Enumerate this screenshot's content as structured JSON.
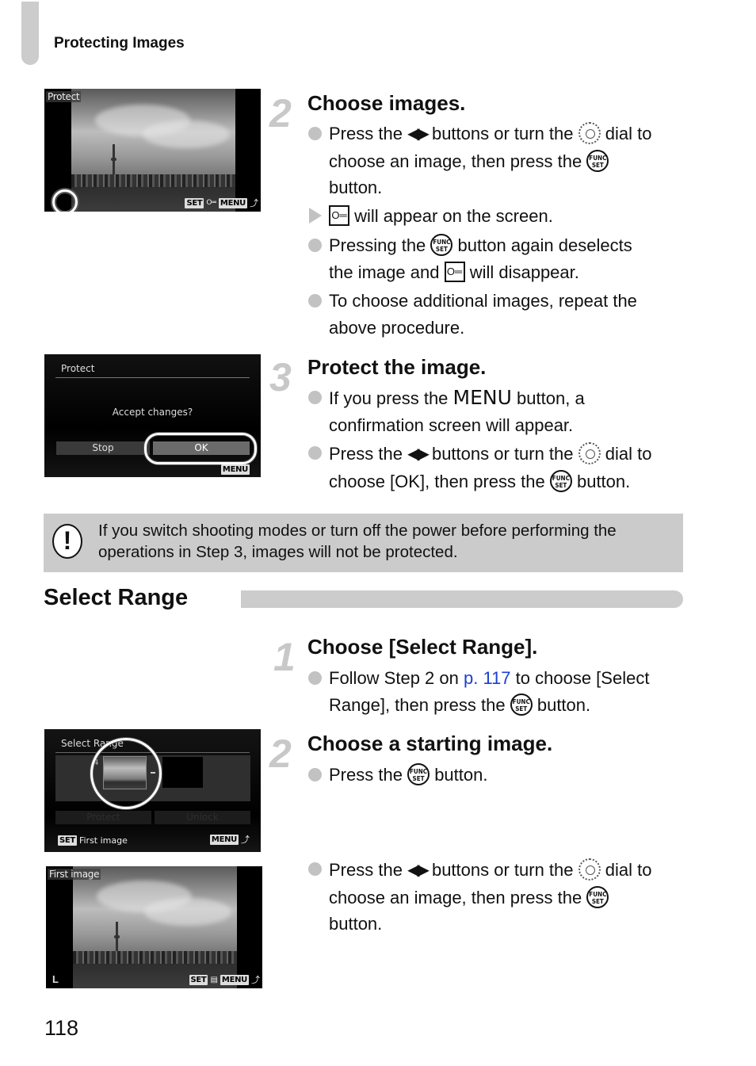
{
  "header": {
    "running_head": "Protecting Images"
  },
  "screens": {
    "choose_images": {
      "label": "Protect",
      "osd_set": "SET",
      "osd_key": "O═",
      "osd_menu": "MENU",
      "osd_back": "⤴"
    },
    "protect_confirm": {
      "title": "Protect",
      "question": "Accept changes?",
      "stop_label": "Stop",
      "ok_label": "OK",
      "osd_menu": "MENU"
    },
    "select_range": {
      "title": "Select Range",
      "counter": "4",
      "protect_label": "Protect",
      "unlock_label": "Unlock",
      "osd_set": "SET",
      "hint": "First image",
      "osd_menu": "MENU"
    },
    "first_image": {
      "label": "First image",
      "size_indicator": "L",
      "osd_set": "SET",
      "osd_menu": "MENU"
    }
  },
  "steps_protect": [
    {
      "number": "2",
      "title": "Choose images.",
      "items": [
        {
          "type": "bullet",
          "parts": [
            "Press the",
            "buttons or turn the",
            "dial to",
            "choose an image, then press the",
            "button."
          ]
        },
        {
          "type": "arrow",
          "parts": [
            "will appear on the screen."
          ]
        },
        {
          "type": "bullet",
          "parts": [
            "Pressing the",
            "button again deselects",
            "the image and",
            "will disappear."
          ]
        },
        {
          "type": "bullet",
          "parts": [
            "To choose additional images, repeat the",
            "above procedure."
          ]
        }
      ]
    },
    {
      "number": "3",
      "title": "Protect the image.",
      "items": [
        {
          "type": "bullet",
          "parts": [
            "If you press the",
            "MENU",
            "button, a",
            "confirmation screen will appear."
          ]
        },
        {
          "type": "bullet",
          "parts": [
            "Press the",
            "buttons or turn the",
            "dial to",
            "choose [OK], then press the",
            "button."
          ]
        }
      ]
    }
  ],
  "caution": {
    "text": "If you switch shooting modes or turn off the power before performing the operations in Step 3, images will not be protected."
  },
  "section": {
    "title": "Select Range"
  },
  "steps_range": [
    {
      "number": "1",
      "title": "Choose [Select Range].",
      "items": [
        {
          "type": "bullet",
          "parts": [
            "Follow Step 2 on",
            "p. 117",
            "to choose [Select",
            "Range], then press the",
            "button."
          ]
        }
      ]
    },
    {
      "number": "2",
      "title": "Choose a starting image.",
      "items": [
        {
          "type": "bullet",
          "parts": [
            "Press the",
            "button."
          ]
        },
        {
          "type": "bullet",
          "parts": [
            "Press the",
            "buttons or turn the",
            "dial to",
            "choose an image, then press the",
            "button."
          ]
        }
      ]
    }
  ],
  "icons": {
    "left_right": "◀▶",
    "key": "O═",
    "func_top": "FUNC",
    "func_bottom": "SET"
  },
  "footer": {
    "page_number": "118"
  }
}
